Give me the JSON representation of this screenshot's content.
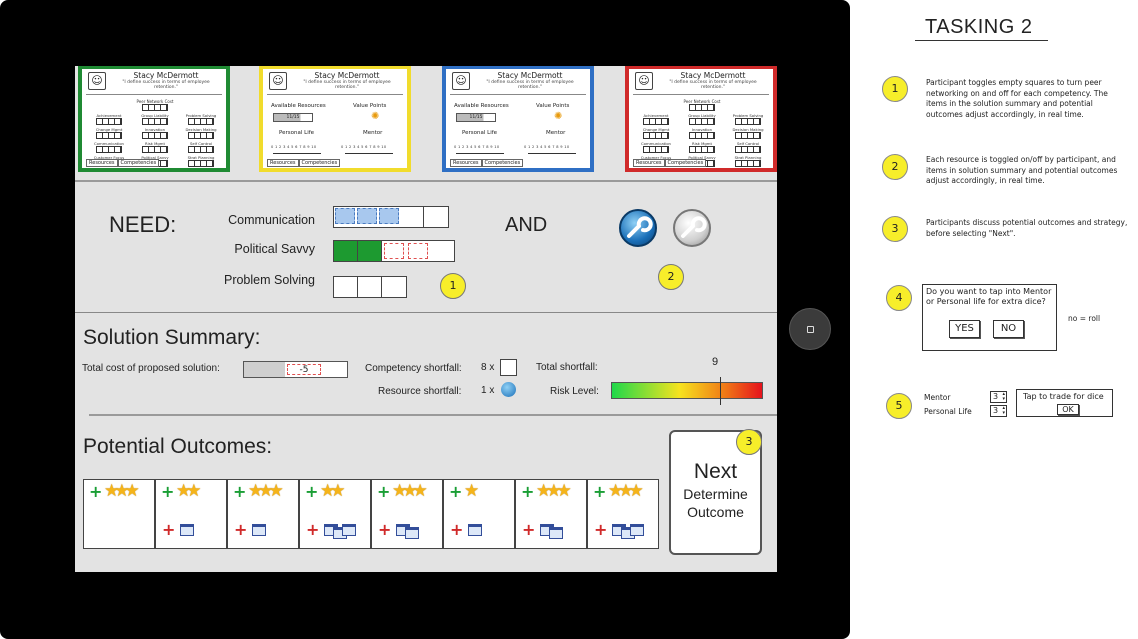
{
  "tasking": {
    "title": "TASKING 2"
  },
  "cards": [
    {
      "name": "Stacy McDermott",
      "quote": "\"I define success in terms of employee retention.\"",
      "color": "#1f8a33",
      "tab1": "Resources",
      "tab2": "Competencies",
      "view": "competencies"
    },
    {
      "name": "Stacy McDermott",
      "quote": "\"I define success in terms of employee retention.\"",
      "color": "#f1dc2c",
      "tab1": "Resources",
      "tab2": "Competencies",
      "view": "resources"
    },
    {
      "name": "Stacy McDermott",
      "quote": "\"I define success in terms of employee retention.\"",
      "color": "#2f6fc4",
      "tab1": "Resources",
      "tab2": "Competencies",
      "view": "resources"
    },
    {
      "name": "Stacy McDermott",
      "quote": "\"I define success in terms of employee retention.\"",
      "color": "#d02a2a",
      "tab1": "Resources",
      "tab2": "Competencies",
      "view": "competencies"
    }
  ],
  "card_competency": {
    "network": "Peer Network Cost",
    "rows": [
      [
        "Achievement",
        "Group Liability",
        "Problem Solving"
      ],
      [
        "Change Mgmt",
        "Innovation",
        "Decision Making"
      ],
      [
        "Communication",
        "Risk Mgmt",
        "Self Control"
      ],
      [
        "Customer Focus",
        "Political Savvy",
        "Strat Planning"
      ]
    ]
  },
  "card_resources": {
    "available": "Available Resources",
    "bar": "11/15",
    "value_points": "Value Points",
    "personal": "Personal Life",
    "mentor": "Mentor",
    "scale": "0 1 2 3 4 5 6 7 8 9 10"
  },
  "need": {
    "label": "NEED:",
    "and": "AND",
    "competencies": [
      {
        "name": "Communication"
      },
      {
        "name": "Political Savvy"
      },
      {
        "name": "Problem Solving"
      }
    ]
  },
  "summary": {
    "title": "Solution Summary:",
    "total_cost_label": "Total cost of proposed solution:",
    "total_cost_value": "-5",
    "competency_shortfall_label": "Competency shortfall:",
    "competency_shortfall_value": "8 x",
    "resource_shortfall_label": "Resource shortfall:",
    "resource_shortfall_value": "1 x",
    "total_shortfall_label": "Total shortfall:",
    "total_shortfall_value": "9",
    "risk_label": "Risk Level:",
    "risk_level": 0.72
  },
  "outcomes": {
    "title": "Potential Outcomes:",
    "items": [
      {
        "plus": "+",
        "stars": "★★★",
        "minus": "",
        "cals": 0
      },
      {
        "plus": "+",
        "stars": "★★",
        "minus": "+",
        "cals": 1
      },
      {
        "plus": "+",
        "stars": "★★★",
        "minus": "+",
        "cals": 1
      },
      {
        "plus": "+",
        "stars": "★★",
        "minus": "+",
        "cals": 3
      },
      {
        "plus": "+",
        "stars": "★★★",
        "minus": "+",
        "cals": 2
      },
      {
        "plus": "+",
        "stars": "★",
        "minus": "+",
        "cals": 1
      },
      {
        "plus": "+",
        "stars": "★★★",
        "minus": "+",
        "cals": 2
      },
      {
        "plus": "+",
        "stars": "★★★",
        "minus": "+",
        "cals": 3
      }
    ]
  },
  "next": {
    "line1": "Next",
    "line2": "Determine",
    "line3": "Outcome"
  },
  "markers": {
    "m1": "1",
    "m2": "2",
    "m3": "3",
    "m4": "4",
    "m5": "5"
  },
  "notes": {
    "n1": "Participant toggles empty squares to turn peer networking on and off for each competency. The items in the solution summary and potential outcomes adjust accordingly, in real time.",
    "n2": "Each resource is toggled on/off by participant, and items in solution summary and potential outcomes adjust accordingly, in real time.",
    "n3": "Participants discuss potential outcomes and strategy, before selecting \"Next\"."
  },
  "dialog": {
    "question": "Do you want to tap into Mentor or Personal life for extra dice?",
    "yes": "YES",
    "no": "NO",
    "note": "no = roll"
  },
  "trade": {
    "mentor_label": "Mentor",
    "mentor_value": "3",
    "personal_label": "Personal Life",
    "personal_value": "3",
    "tap_label": "Tap to trade for dice",
    "ok": "OK"
  },
  "colors": {
    "screen": "#e3e3e3",
    "marker": "#f7ee2a",
    "plus": "#1a9e35",
    "minus": "#d02a2a"
  }
}
